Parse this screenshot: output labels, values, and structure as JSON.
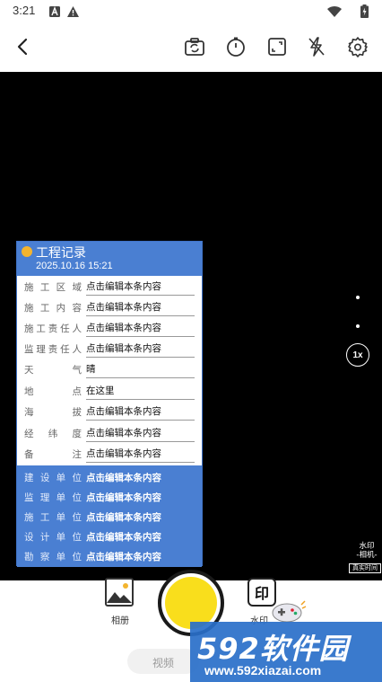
{
  "status_bar": {
    "time": "3:21",
    "icons": [
      "notification-a-icon",
      "warning-icon",
      "wifi-icon",
      "battery-charging-icon"
    ]
  },
  "toolbar": {
    "back_icon": "back-arrow-icon",
    "icons": [
      "camera-flip-icon",
      "timer-icon",
      "aspect-ratio-icon",
      "flash-off-icon",
      "settings-gear-icon"
    ]
  },
  "watermark": {
    "title": "工程记录",
    "datetime": "2025.10.16 15:21",
    "rows": [
      {
        "label": "施工区域",
        "value": "点击编辑本条内容"
      },
      {
        "label": "施工内容",
        "value": "点击编辑本条内容"
      },
      {
        "label": "施工责任人",
        "value": "点击编辑本条内容"
      },
      {
        "label": "监理责任人",
        "value": "点击编辑本条内容"
      },
      {
        "label": "天气",
        "value": "晴"
      },
      {
        "label": "地点",
        "value": "在这里"
      },
      {
        "label": "海拔",
        "value": "点击编辑本条内容"
      },
      {
        "label": "经纬度",
        "value": "点击编辑本条内容"
      },
      {
        "label": "备注",
        "value": "点击编辑本条内容"
      }
    ],
    "units": [
      {
        "label": "建设单位",
        "value": "点击编辑本条内容"
      },
      {
        "label": "监理单位",
        "value": "点击编辑本条内容"
      },
      {
        "label": "施工单位",
        "value": "点击编辑本条内容"
      },
      {
        "label": "设计单位",
        "value": "点击编辑本条内容"
      },
      {
        "label": "勘察单位",
        "value": "点击编辑本条内容"
      }
    ]
  },
  "zoom": {
    "label": "1x"
  },
  "camera_tag": {
    "line1": "水印",
    "line2": "-相机-",
    "sub": "真实时间"
  },
  "bottom": {
    "album_label": "相册",
    "stamp_glyph": "印",
    "stamp_label": "水印",
    "mode_label": "视频"
  },
  "site_watermark": {
    "logo": "592软件园",
    "url": "www.592xiazai.com"
  },
  "colors": {
    "watermark_blue": "#4a7fd2",
    "shutter_yellow": "#f9de1c",
    "site_blue": "#2a6fc9"
  }
}
